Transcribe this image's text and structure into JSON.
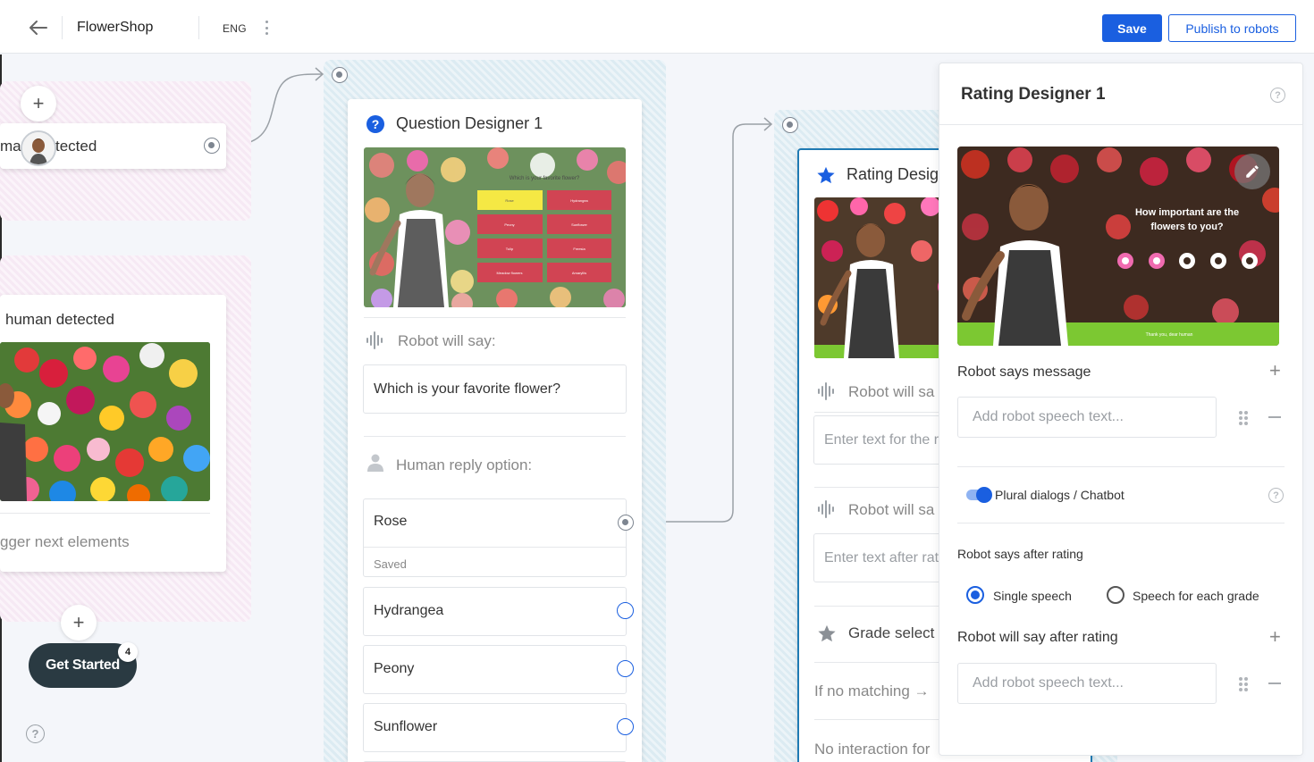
{
  "header": {
    "app_title": "FlowerShop",
    "language": "ENG",
    "save_label": "Save",
    "publish_label": "Publish to robots"
  },
  "left_nodes": {
    "face_node_text_prefix": "ma",
    "face_node_text_suffix": "tected",
    "human_node_title": "human detected",
    "human_node_footer": "gger next elements",
    "get_started_label": "Get Started",
    "get_started_badge": "4"
  },
  "question_designer": {
    "title": "Question Designer 1",
    "scene_question": "Which is your favorite flower?",
    "scene_options": [
      "Rose",
      "Hydrangea",
      "Peony",
      "Sunflower",
      "Tulip",
      "Freesia",
      "Meadow flowers",
      "Amaryllis"
    ],
    "robot_will_say_label": "Robot will say:",
    "robot_speech": "Which is your favorite flower?",
    "human_reply_label": "Human reply option:",
    "options": [
      {
        "label": "Rose",
        "status": "Saved"
      },
      {
        "label": "Hydrangea"
      },
      {
        "label": "Peony"
      },
      {
        "label": "Sunflower"
      }
    ]
  },
  "rating_node": {
    "title": "Rating Desig",
    "robot_will_say_1": "Robot will sa",
    "placeholder_1": "Enter text for the r",
    "robot_will_say_2": "Robot will sa",
    "placeholder_2": "Enter text after rati",
    "grade_select_label": "Grade select",
    "no_matching_label": "If no matching →",
    "no_interaction_label": "No interaction for"
  },
  "panel": {
    "title": "Rating Designer 1",
    "preview_question": "How important are the flowers to you?",
    "preview_footer": "Thank you, dear human",
    "robot_says_message_label": "Robot says message",
    "speech_placeholder_1": "Add robot speech text...",
    "plural_dialogs_label": "Plural dialogs / Chatbot",
    "plural_dialogs_on": true,
    "robot_says_after_rating_label": "Robot says after rating",
    "radio_options": [
      "Single speech",
      "Speech for each grade"
    ],
    "radio_selected": "Single speech",
    "robot_will_say_after_rating_label": "Robot will say after rating",
    "speech_placeholder_2": "Add robot speech text..."
  },
  "colors": {
    "accent": "#1a5fe0",
    "scene_green": "#7cc832",
    "rating_flowers_pink": "#f06bb0"
  }
}
